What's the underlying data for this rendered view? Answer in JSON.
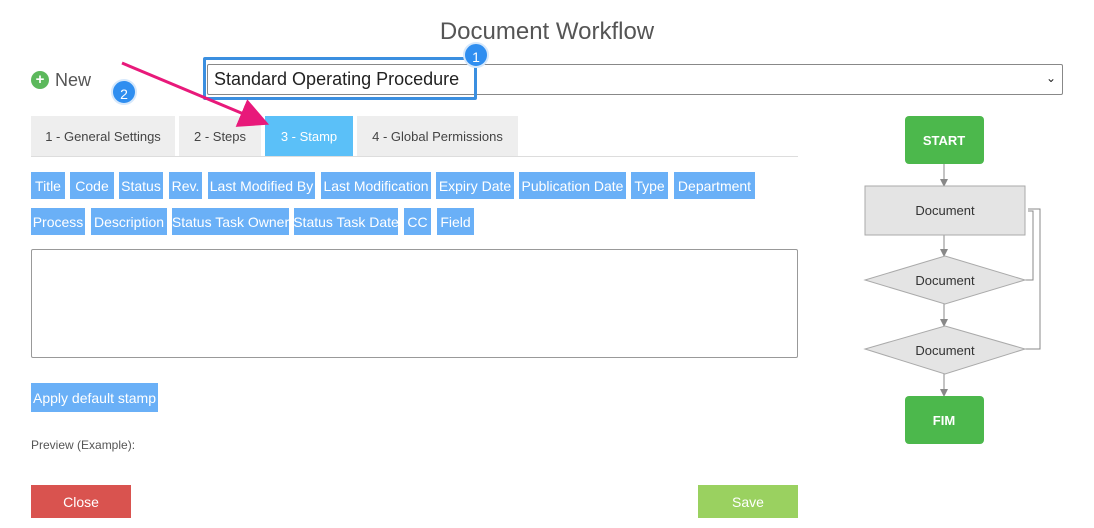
{
  "page": {
    "title": "Document Workflow"
  },
  "toolbar": {
    "new_label": "New"
  },
  "workflow_select": {
    "value": "Standard Operating Procedure"
  },
  "markers": [
    "1",
    "2"
  ],
  "tabs": [
    {
      "label": "1 - General Settings",
      "active": false
    },
    {
      "label": "2 - Steps",
      "active": false
    },
    {
      "label": "3 - Stamp",
      "active": true
    },
    {
      "label": "4 - Global Permissions",
      "active": false
    }
  ],
  "fields_row1": [
    "Title",
    "Code",
    "Status",
    "Rev.",
    "Last Modified By",
    "Last Modification",
    "Expiry Date",
    "Publication Date",
    "Type",
    "Department"
  ],
  "fields_row2": [
    "Process",
    "Description",
    "Status Task Owner",
    "Status Task Date",
    "CC",
    "Field"
  ],
  "stamp": {
    "value": "",
    "apply_default_label": "Apply default stamp",
    "preview_label": "Preview (Example):"
  },
  "actions": {
    "close_label": "Close",
    "save_label": "Save"
  },
  "flow": {
    "start": "START",
    "nodes": [
      "Document",
      "Document",
      "Document"
    ],
    "end": "FIM"
  },
  "colors": {
    "accent_tab": "#5bc0f8",
    "field_button": "#6ab0f7",
    "close": "#d9534f",
    "save": "#9ad160",
    "flow_terminal": "#4cb84c",
    "annotation_arrow": "#e8197a",
    "marker": "#2f8ef0"
  }
}
